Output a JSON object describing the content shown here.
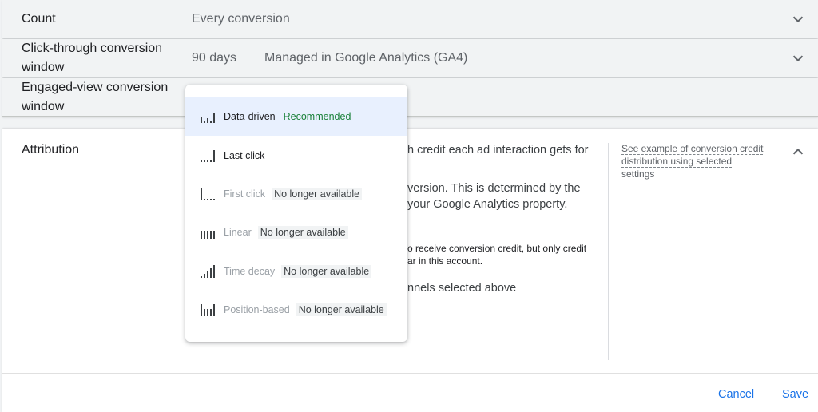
{
  "rows": {
    "count": {
      "label": "Count",
      "value": "Every conversion"
    },
    "click_through": {
      "label_line1": "Click-through conversion",
      "label_line2": "window",
      "value": "90 days",
      "note": "Managed in Google Analytics (GA4)"
    },
    "engaged_view": {
      "label_line1": "Engaged-view conversion",
      "label_line2": "window"
    }
  },
  "attribution": {
    "label": "Attribution",
    "text_line1": "h credit each ad interaction gets for",
    "text_line2": "version. This is determined by the",
    "text_line3": "your Google Analytics property.",
    "small_line1": "o receive conversion credit, but only credit",
    "small_line2": "ar in this account.",
    "text_line4": "nnels selected above",
    "see_example_line1": "See example of conversion credit",
    "see_example_line2": "distribution using selected",
    "see_example_line3": "settings"
  },
  "menu": {
    "items": [
      {
        "label": "Data-driven",
        "badge": "Recommended",
        "icon": "data-driven-icon",
        "selected": true,
        "disabled": false
      },
      {
        "label": "Last click",
        "badge": "",
        "icon": "last-click-icon",
        "selected": false,
        "disabled": false
      },
      {
        "label": "First click",
        "badge": "No longer available",
        "icon": "first-click-icon",
        "selected": false,
        "disabled": true
      },
      {
        "label": "Linear",
        "badge": "No longer available",
        "icon": "linear-icon",
        "selected": false,
        "disabled": true
      },
      {
        "label": "Time decay",
        "badge": "No longer available",
        "icon": "time-decay-icon",
        "selected": false,
        "disabled": true
      },
      {
        "label": "Position-based",
        "badge": "No longer available",
        "icon": "position-based-icon",
        "selected": false,
        "disabled": true
      }
    ]
  },
  "footer": {
    "cancel_label": "Cancel",
    "save_label": "Save"
  },
  "colors": {
    "accent": "#1a73e8",
    "recommended": "#188038",
    "selected_bg": "#e8f0fe"
  }
}
